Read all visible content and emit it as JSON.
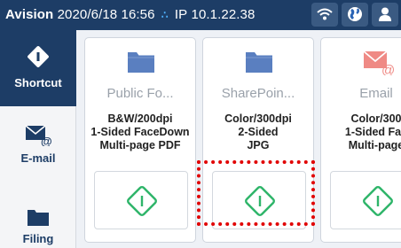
{
  "status": {
    "brand": "Avision",
    "datetime": "2020/6/18 16:56",
    "ip_label": "IP",
    "ip": "10.1.22.38",
    "icons": [
      "wifi-icon",
      "globe-icon",
      "user-icon"
    ]
  },
  "sidebar": {
    "items": [
      {
        "label": "Shortcut",
        "icon": "diamond-icon",
        "active": true
      },
      {
        "label": "E-mail",
        "icon": "email-icon",
        "active": false
      },
      {
        "label": "Filing",
        "icon": "folder-icon",
        "active": false
      }
    ]
  },
  "cards": [
    {
      "name": "Public Fo...",
      "line1": "B&W/200dpi",
      "line2": "1-Sided FaceDown",
      "line3": "Multi-page PDF",
      "icon": "folder-icon"
    },
    {
      "name": "SharePoin...",
      "line1": "Color/300dpi",
      "line2": "2-Sided",
      "line3": "JPG",
      "icon": "folder-icon"
    },
    {
      "name": "Email",
      "line1": "Color/300",
      "line2": "1-Sided Fac",
      "line3": "Multi-page",
      "icon": "email-icon"
    }
  ],
  "colors": {
    "status_bar": "#1d3d66",
    "accent_green": "#2fb56a",
    "folder_blue": "#1d3d66",
    "card_folder_blue": "#5a7fc0",
    "email_icon": "#ef8a85",
    "highlight": "#e10000"
  }
}
